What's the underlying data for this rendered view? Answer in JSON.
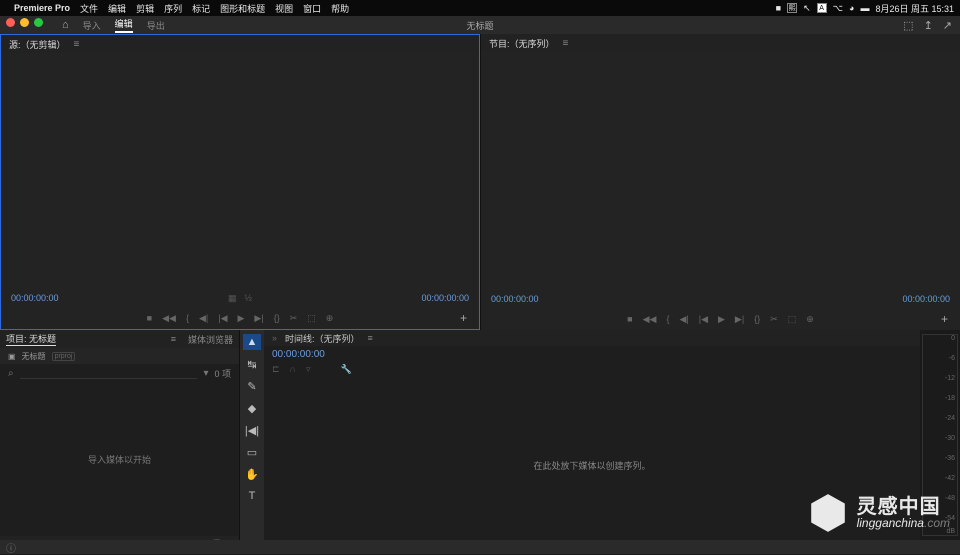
{
  "menubar": {
    "app": "Premiere Pro",
    "items": [
      "文件",
      "编辑",
      "剪辑",
      "序列",
      "标记",
      "图形和标题",
      "视图",
      "窗口",
      "帮助"
    ],
    "status_icons": [
      "熙",
      "A"
    ],
    "date_time": "8月26日 周五 15:31"
  },
  "workspace": {
    "tabs": [
      "导入",
      "编辑",
      "导出"
    ],
    "active_index": 1,
    "title": "无标题",
    "right_icons": [
      "⬚",
      "↥",
      "↗"
    ]
  },
  "source_panel": {
    "tab": "源:（无剪辑）",
    "tc_in": "00:00:00:00",
    "tc_out": "00:00:00:00"
  },
  "program_panel": {
    "tab": "节目:（无序列）",
    "tc_in": "00:00:00:00",
    "tc_out": "00:00:00:00"
  },
  "transport": [
    "■",
    "◀◀",
    "{",
    "◀|",
    "|◀",
    "▶",
    "▶|",
    "{}",
    "✂",
    "⬚",
    "⊕"
  ],
  "project": {
    "tabs": [
      "项目: 无标题",
      "媒体浏览器"
    ],
    "bin_name": "无标题",
    "bin_badge": "prproj",
    "search_placeholder": "",
    "item_count": "0 项",
    "empty_hint": "导入媒体以开始"
  },
  "tools": [
    "▲",
    "↹",
    "✎",
    "◆",
    "|◀|",
    "▭",
    "✋",
    "T"
  ],
  "timeline": {
    "tab": "时间线:（无序列）",
    "tc": "00:00:00:00",
    "empty_hint": "在此处放下媒体以创建序列。"
  },
  "meter_ticks": [
    "0",
    "-6",
    "-12",
    "-18",
    "-24",
    "-30",
    "-36",
    "-42",
    "-48",
    "-54",
    "dB"
  ],
  "watermark": {
    "cn": "灵感中国",
    "en": "lingganchina",
    "dom": ".com"
  }
}
